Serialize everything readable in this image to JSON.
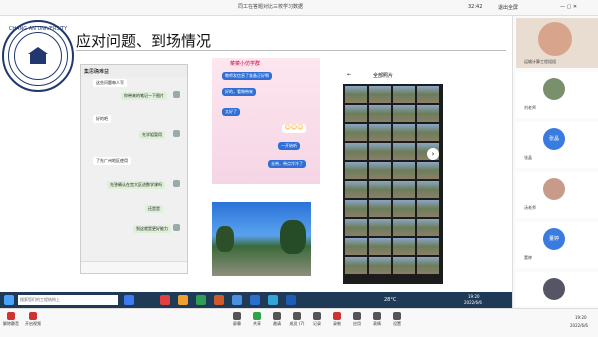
{
  "meeting": {
    "window_title": "同工在答题对比三校学习数据",
    "clock": "32:42",
    "right_label": "退出全屏"
  },
  "slide": {
    "heading": "应对问题、到场情况",
    "logo_text": "CHANG AN UNIVERSITY",
    "chat1": {
      "title": "集思确难益",
      "msgs": [
        {
          "side": "l",
          "text": "这些问题每人写"
        },
        {
          "side": "r",
          "text": "你带来的笔记一下图片"
        },
        {
          "side": "l",
          "text": "好的吧"
        },
        {
          "side": "r",
          "text": "先学姐暂用"
        },
        {
          "side": "l",
          "text": "了先广州地区使用"
        },
        {
          "side": "r",
          "text": "先答确认在宫大区进数学课吗"
        },
        {
          "side": "r",
          "text": "还是是"
        },
        {
          "side": "r",
          "text": "到这就是更好能力"
        }
      ]
    },
    "chat2": {
      "title": "菜菜小仿学群",
      "msgs": [
        "教师发信息了准备正好啊",
        "好的，看物带来",
        "太好了",
        "一开始听",
        "去带，带点冷冷了"
      ]
    },
    "album": {
      "title": "全部照片"
    }
  },
  "participants": [
    {
      "name": "运输计算工程组组"
    },
    {
      "name": "刘老师"
    },
    {
      "name": "张晶"
    },
    {
      "name": "汤老师"
    },
    {
      "name": "董婷"
    },
    {
      "name": "闫晓"
    },
    {
      "name": "董老师"
    }
  ],
  "wintask": {
    "search_placeholder": "搜索您们的工程结构上",
    "weather": "28°C",
    "time": "19:20",
    "date": "2022/6/6"
  },
  "meettool": {
    "buttons": [
      "屏幕",
      "共享",
      "邀请",
      "成员 (7)",
      "记录",
      "录制",
      "应用",
      "表情",
      "设置"
    ],
    "mute_label": "解除静音",
    "camera_label": "开启视频",
    "time": "19:20",
    "date": "2022/6/6"
  }
}
